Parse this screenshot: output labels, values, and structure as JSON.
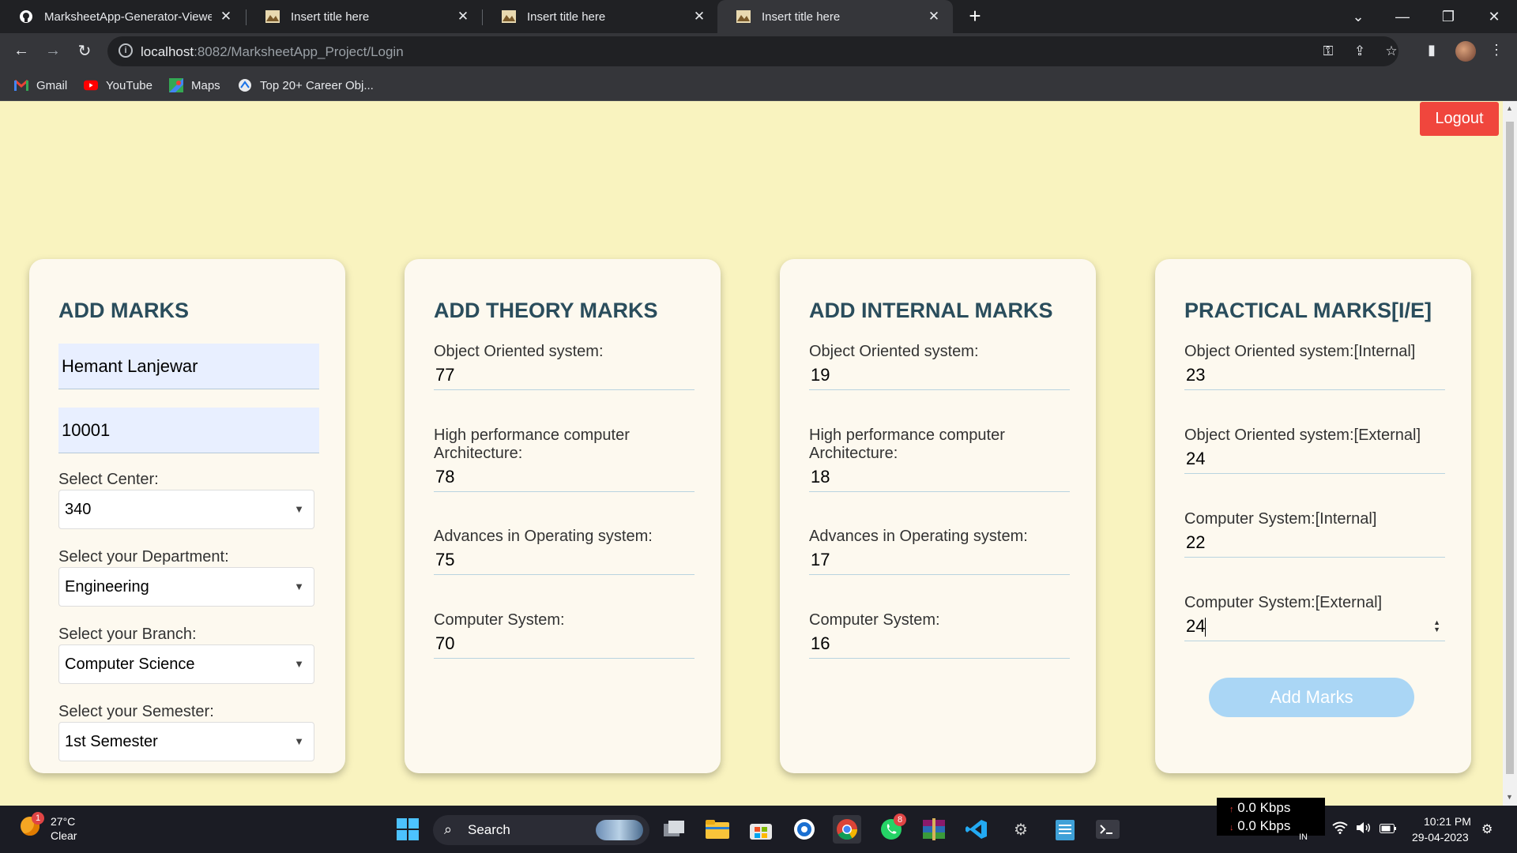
{
  "browser": {
    "tabs": [
      {
        "title": "MarksheetApp-Generator-Viewer",
        "active": false
      },
      {
        "title": "Insert title here",
        "active": false
      },
      {
        "title": "Insert title here",
        "active": false
      },
      {
        "title": "Insert title here",
        "active": true
      }
    ],
    "url_host": "localhost",
    "url_path": ":8082/MarksheetApp_Project/Login",
    "bookmarks": [
      "Gmail",
      "YouTube",
      "Maps",
      "Top 20+ Career Obj..."
    ]
  },
  "page": {
    "logout_label": "Logout",
    "add_marks": {
      "title": "ADD MARKS",
      "student_name": "Hemant Lanjewar",
      "roll_no": "10001",
      "center_label": "Select Center:",
      "center_value": "340",
      "department_label": "Select your Department:",
      "department_value": "Engineering",
      "branch_label": "Select your Branch:",
      "branch_value": "Computer Science",
      "semester_label": "Select your Semester:",
      "semester_value": "1st Semester"
    },
    "theory": {
      "title": "ADD THEORY MARKS",
      "fields": [
        {
          "label": "Object Oriented system:",
          "value": "77"
        },
        {
          "label": "High performance computer Architecture:",
          "value": "78"
        },
        {
          "label": "Advances in Operating system:",
          "value": "75"
        },
        {
          "label": "Computer System:",
          "value": "70"
        }
      ]
    },
    "internal": {
      "title": "ADD INTERNAL MARKS",
      "fields": [
        {
          "label": "Object Oriented system:",
          "value": "19"
        },
        {
          "label": "High performance computer Architecture:",
          "value": "18"
        },
        {
          "label": "Advances in Operating system:",
          "value": "17"
        },
        {
          "label": "Computer System:",
          "value": "16"
        }
      ]
    },
    "practical": {
      "title": "PRACTICAL MARKS[I/E]",
      "fields": [
        {
          "label": "Object Oriented system:[Internal]",
          "value": "23"
        },
        {
          "label": "Object Oriented system:[External]",
          "value": "24"
        },
        {
          "label": "Computer System:[Internal]",
          "value": "22"
        },
        {
          "label": "Computer System:[External]",
          "value": "24"
        }
      ],
      "submit_label": "Add Marks"
    }
  },
  "taskbar": {
    "weather_temp": "27°C",
    "weather_desc": "Clear",
    "weather_badge": "1",
    "search_label": "Search",
    "whatsapp_badge": "8",
    "net_up": "0.0 Kbps",
    "net_down": "0.0 Kbps",
    "lang": "IN",
    "time": "10:21 PM",
    "date": "29-04-2023"
  }
}
